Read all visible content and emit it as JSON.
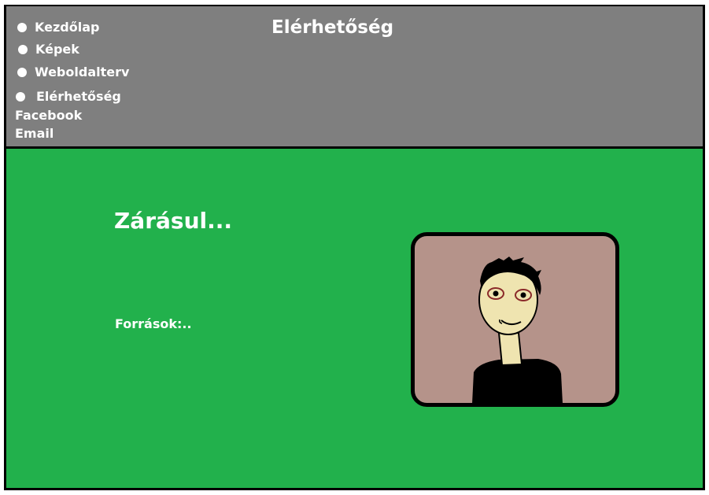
{
  "header": {
    "title": "Elérhetőség",
    "nav": [
      {
        "label": "Kezdőlap"
      },
      {
        "label": "Képek"
      },
      {
        "label": "Weboldalterv"
      },
      {
        "label": "Elérhetőség"
      }
    ],
    "links": [
      {
        "label": "Facebook"
      },
      {
        "label": "Email"
      }
    ]
  },
  "main": {
    "heading": "Zárásul...",
    "sources_label": "Források:.."
  },
  "colors": {
    "header_bg": "#7f7f7f",
    "main_bg": "#22b14c",
    "text": "#ffffff",
    "portrait_bg": "#b5938a"
  }
}
